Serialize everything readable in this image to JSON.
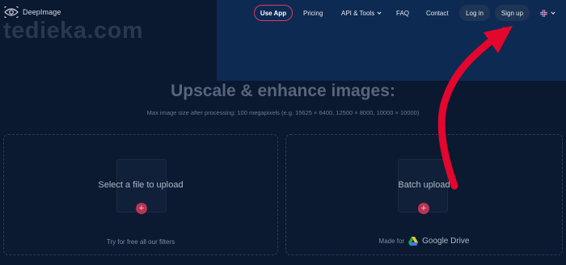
{
  "brand": {
    "name": "DeepImage"
  },
  "watermark": "tediek​a.com",
  "nav": {
    "use_app": "Use App",
    "pricing": "Pricing",
    "api_tools": "API & Tools",
    "faq": "FAQ",
    "contact": "Contact",
    "login": "Log in",
    "signup": "Sign up"
  },
  "hero": {
    "title": "Upscale & enhance images:",
    "subtitle": "Max image size after processing: 100 megapixels (e.g. 15625 × 6400, 12500 × 8000, 10000 × 10000)"
  },
  "upload": {
    "select_label": "Select a file to upload",
    "select_footer": "Try for free all our filters",
    "batch_label": "Batch upload",
    "batch_footer_prefix": "Made for",
    "batch_footer_brand": "Google Drive",
    "plus_symbol": "+"
  },
  "colors": {
    "accent": "#e23a5e",
    "arrow": "#e3062d",
    "background": "#0a1830"
  }
}
